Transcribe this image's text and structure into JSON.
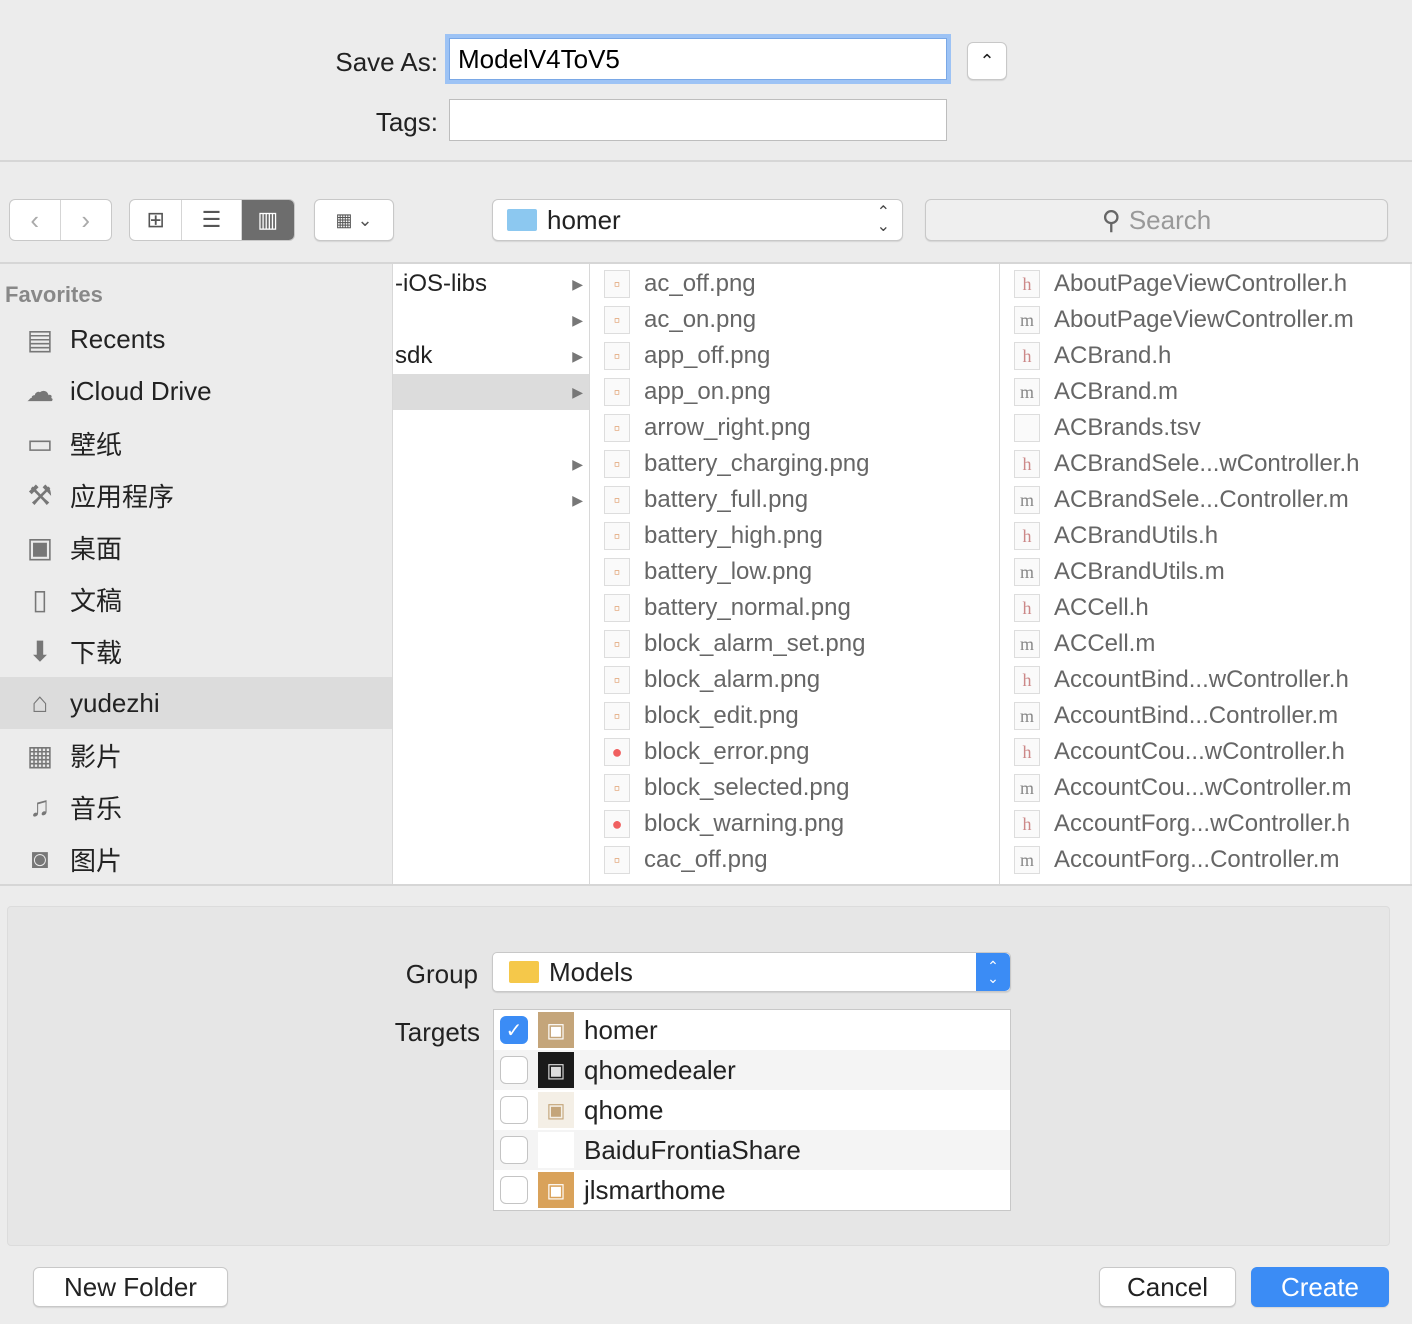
{
  "save_as": {
    "label": "Save As:",
    "value": "ModelV4ToV5"
  },
  "tags": {
    "label": "Tags:",
    "value": ""
  },
  "toolbar": {
    "location": "homer",
    "search_placeholder": "Search"
  },
  "sidebar": {
    "heading": "Favorites",
    "items": [
      {
        "label": "Recents",
        "icon": "recents-icon",
        "glyph": "▤"
      },
      {
        "label": "iCloud Drive",
        "icon": "cloud-icon",
        "glyph": "☁"
      },
      {
        "label": "壁纸",
        "icon": "folder-icon",
        "glyph": "▭"
      },
      {
        "label": "应用程序",
        "icon": "applications-icon",
        "glyph": "⚒"
      },
      {
        "label": "桌面",
        "icon": "desktop-icon",
        "glyph": "▣"
      },
      {
        "label": "文稿",
        "icon": "documents-icon",
        "glyph": "▯"
      },
      {
        "label": "下载",
        "icon": "downloads-icon",
        "glyph": "⬇"
      },
      {
        "label": "yudezhi",
        "icon": "home-icon",
        "glyph": "⌂",
        "selected": true
      },
      {
        "label": "影片",
        "icon": "movies-icon",
        "glyph": "▦"
      },
      {
        "label": "音乐",
        "icon": "music-icon",
        "glyph": "♫"
      },
      {
        "label": "图片",
        "icon": "pictures-icon",
        "glyph": "◙"
      }
    ]
  },
  "column1": [
    {
      "label": "-iOS-libs",
      "arrow": true
    },
    {
      "label": "",
      "arrow": true
    },
    {
      "label": "sdk",
      "arrow": true
    },
    {
      "label": "",
      "arrow": true,
      "selected": true
    },
    {
      "label": "",
      "arrow": false
    },
    {
      "label": "",
      "arrow": true
    },
    {
      "label": "",
      "arrow": true
    }
  ],
  "column2": [
    "ac_off.png",
    "ac_on.png",
    "app_off.png",
    "app_on.png",
    "arrow_right.png",
    "battery_charging.png",
    "battery_full.png",
    "battery_high.png",
    "battery_low.png",
    "battery_normal.png",
    "block_alarm_set.png",
    "block_alarm.png",
    "block_edit.png",
    "block_error.png",
    "block_selected.png",
    "block_warning.png",
    "cac_off.png"
  ],
  "column3": [
    "AboutPageViewController.h",
    "AboutPageViewController.m",
    "ACBrand.h",
    "ACBrand.m",
    "ACBrands.tsv",
    "ACBrandSele...wController.h",
    "ACBrandSele...Controller.m",
    "ACBrandUtils.h",
    "ACBrandUtils.m",
    "ACCell.h",
    "ACCell.m",
    "AccountBind...wController.h",
    "AccountBind...Controller.m",
    "AccountCou...wController.h",
    "AccountCou...wController.m",
    "AccountForg...wController.h",
    "AccountForg...Controller.m"
  ],
  "group": {
    "label": "Group",
    "value": "Models"
  },
  "targets": {
    "label": "Targets",
    "items": [
      {
        "name": "homer",
        "checked": true,
        "icon_bg": "#c4a57a"
      },
      {
        "name": "qhomedealer",
        "checked": false,
        "icon_bg": "#1a1a1a"
      },
      {
        "name": "qhome",
        "checked": false,
        "icon_bg": "#f4efe6"
      },
      {
        "name": "BaiduFrontiaShare",
        "checked": false,
        "icon_bg": "#ffffff"
      },
      {
        "name": "jlsmarthome",
        "checked": false,
        "icon_bg": "#d9a25a"
      }
    ]
  },
  "buttons": {
    "new_folder": "New Folder",
    "cancel": "Cancel",
    "create": "Create"
  },
  "colors": {
    "accent": "#3b8cf5"
  }
}
